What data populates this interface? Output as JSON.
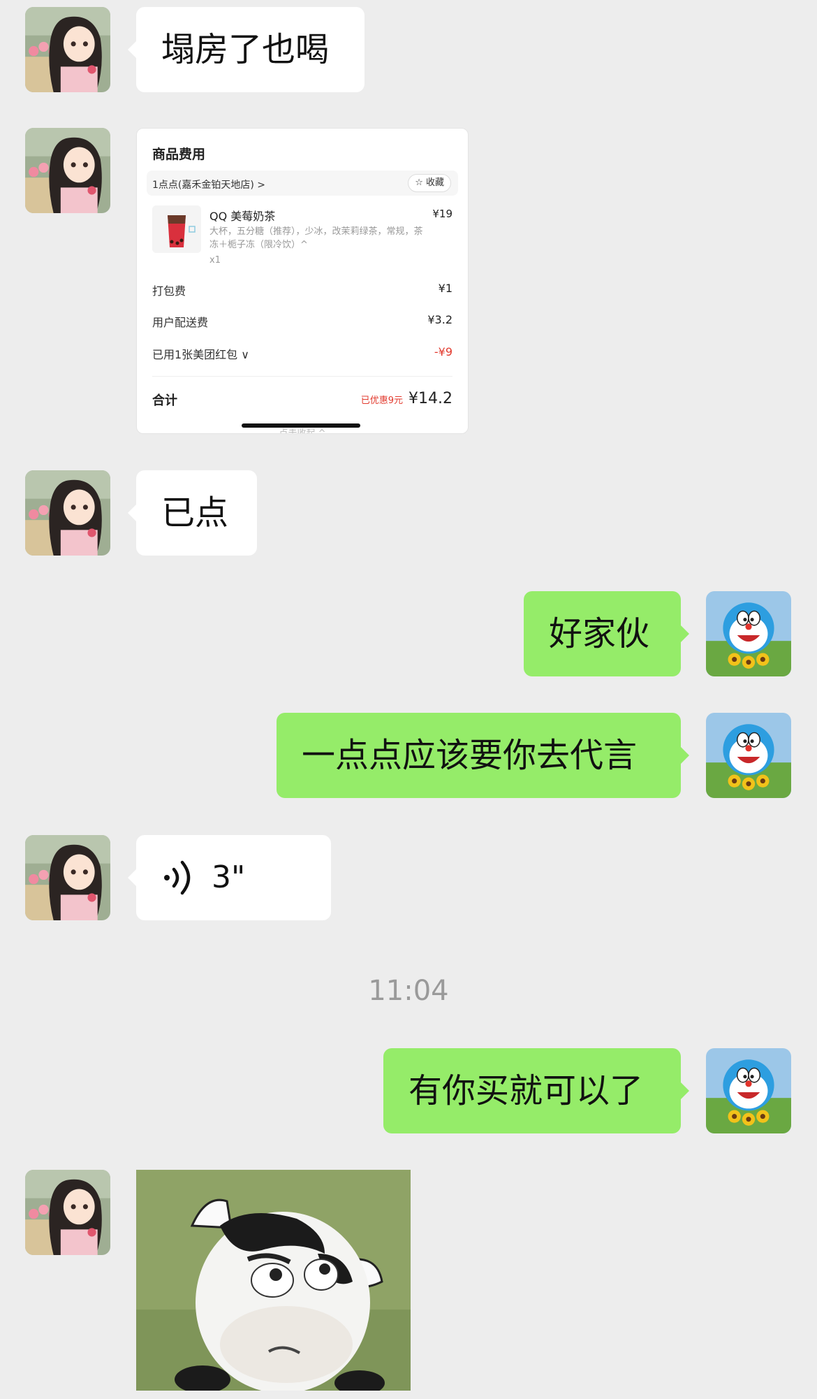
{
  "messages": [
    {
      "type": "text",
      "side": "in",
      "text": "塌房了也喝"
    },
    {
      "type": "order_card",
      "side": "in"
    },
    {
      "type": "text",
      "side": "in",
      "text": "已点"
    },
    {
      "type": "text",
      "side": "out",
      "text": "好家伙"
    },
    {
      "type": "text",
      "side": "out",
      "text": "一点点应该要你去代言"
    },
    {
      "type": "voice",
      "side": "in",
      "duration": "3\""
    },
    {
      "type": "time",
      "text": "11:04"
    },
    {
      "type": "text",
      "side": "out",
      "text": "有你买就可以了"
    },
    {
      "type": "sticker",
      "side": "in",
      "icon": "cow-sticker"
    }
  ],
  "order_card": {
    "title": "商品费用",
    "shop": "1点点(嘉禾金铂天地店) >",
    "favorite_label": "☆ 收藏",
    "product": {
      "name": "QQ 美莓奶茶",
      "price": "¥19",
      "desc": "大杯，五分糖（推荐），少冰，改茉莉绿茶，常规，茶冻＋栀子冻（限冷饮）^",
      "qty": "x1"
    },
    "fees": [
      {
        "label": "打包费",
        "value": "¥1"
      },
      {
        "label": "用户配送费",
        "value": "¥3.2"
      },
      {
        "label": "已用1张美团红包 ∨",
        "value": "-¥9"
      }
    ],
    "total_label": "合计",
    "discount_text": "已优惠9元",
    "total_value": "¥14.2",
    "collapse_text": "点击收起 ^"
  },
  "colors": {
    "background": "#ededed",
    "incoming": "#ffffff",
    "outgoing": "#95ec69",
    "discount_red": "#e23a2e"
  }
}
